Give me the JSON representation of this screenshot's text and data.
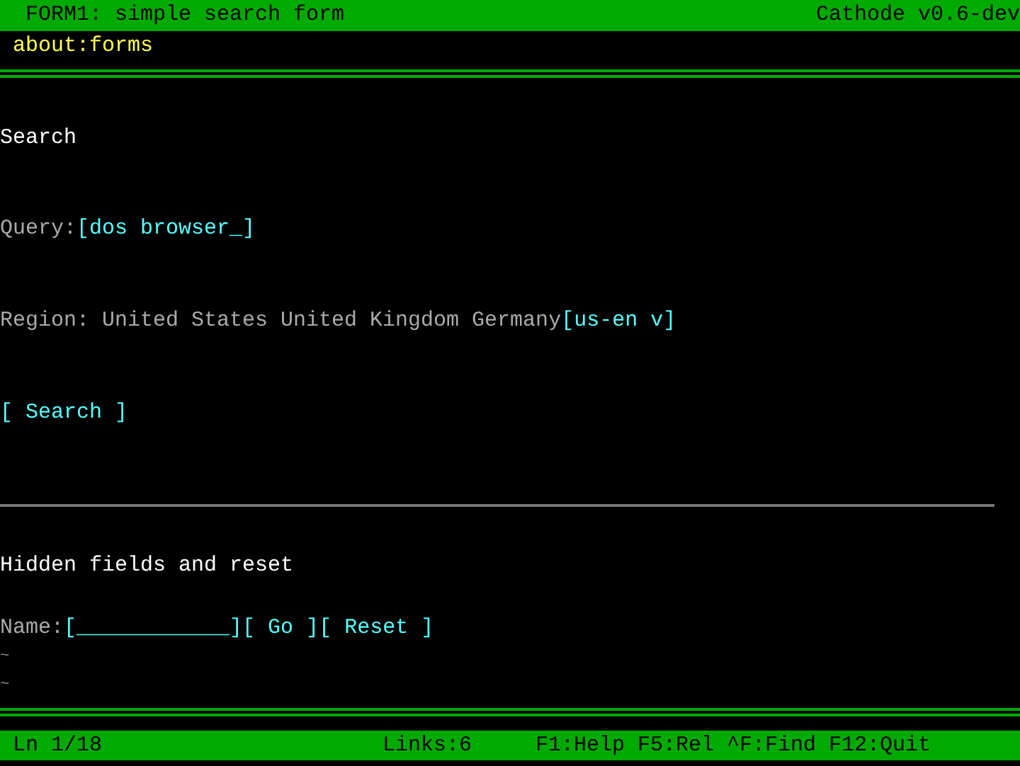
{
  "title_bar": {
    "title": "FORM1: simple search form",
    "app": "Cathode v0.6-dev"
  },
  "address": "about:forms",
  "search_form": {
    "heading": "Search",
    "query": {
      "label": "Query:",
      "value": "[dos browser_]"
    },
    "region": {
      "label": "Region: United States United Kingdom Germany",
      "select": "[us-en v]"
    },
    "submit": "[ Search ]"
  },
  "hidden_form": {
    "heading": "Hidden fields and reset",
    "name": {
      "label": "Name:",
      "value": "[____________]"
    },
    "buttons": [
      "[ Go ]",
      "[ Reset ]"
    ]
  },
  "filler_lines": [
    "~",
    "~"
  ],
  "status_bar": {
    "position": "Ln 1/18",
    "links": "Links:6",
    "keys": "F1:Help F5:Rel ^F:Find F12:Quit"
  }
}
